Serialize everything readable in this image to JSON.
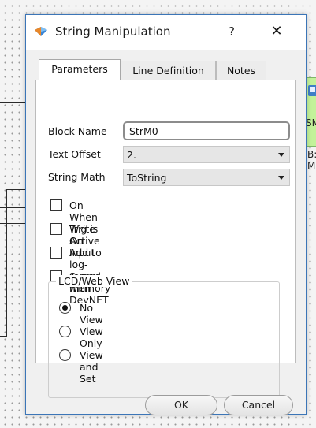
{
  "dialog": {
    "title": "String Manipulation",
    "help": "?",
    "close": "✕"
  },
  "tabs": [
    {
      "label": "Parameters",
      "active": true
    },
    {
      "label": "Line Definition",
      "active": false
    },
    {
      "label": "Notes",
      "active": false
    }
  ],
  "fields": {
    "block_name_label": "Block Name",
    "block_name_value": "StrM0",
    "text_offset_label": "Text Offset",
    "text_offset_value": "2.",
    "string_math_label": "String Math",
    "string_math_value": "ToString"
  },
  "checkboxes": [
    {
      "label": "On When Trig is Active",
      "checked": false
    },
    {
      "label": "Write On Input",
      "checked": false
    },
    {
      "label": "Add to log-record memory",
      "checked": false
    },
    {
      "label": "Sync with DevNET",
      "checked": false
    }
  ],
  "lcd_group": {
    "title": "LCD/Web View",
    "options": [
      {
        "label": "No View",
        "selected": true
      },
      {
        "label": "View Only",
        "selected": false
      },
      {
        "label": "View and Set",
        "selected": false
      }
    ]
  },
  "buttons": {
    "ok": "OK",
    "cancel": "Cancel"
  },
  "background": {
    "block_label": "SM",
    "side_labels": [
      "B:",
      "M:"
    ]
  }
}
